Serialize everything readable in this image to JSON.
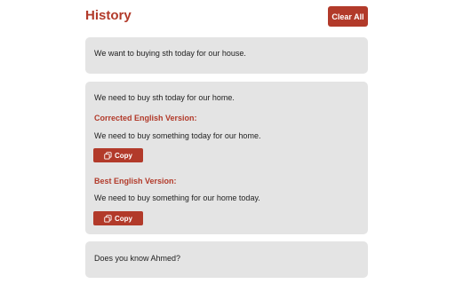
{
  "header": {
    "title": "History",
    "clear_label": "Clear All"
  },
  "history": [
    {
      "input": "We want to buying sth today for our house."
    },
    {
      "input": "We need to buy sth today for our home.",
      "corrected_label": "Corrected English Version:",
      "corrected_text": "We need to buy something today for our home.",
      "best_label": "Best English Version:",
      "best_text": "We need to buy something for our home today.",
      "copy_label": "Copy"
    },
    {
      "input": "Does you know Ahmed?"
    }
  ],
  "colors": {
    "accent": "#b23a2a",
    "card_bg": "#e4e4e4"
  }
}
